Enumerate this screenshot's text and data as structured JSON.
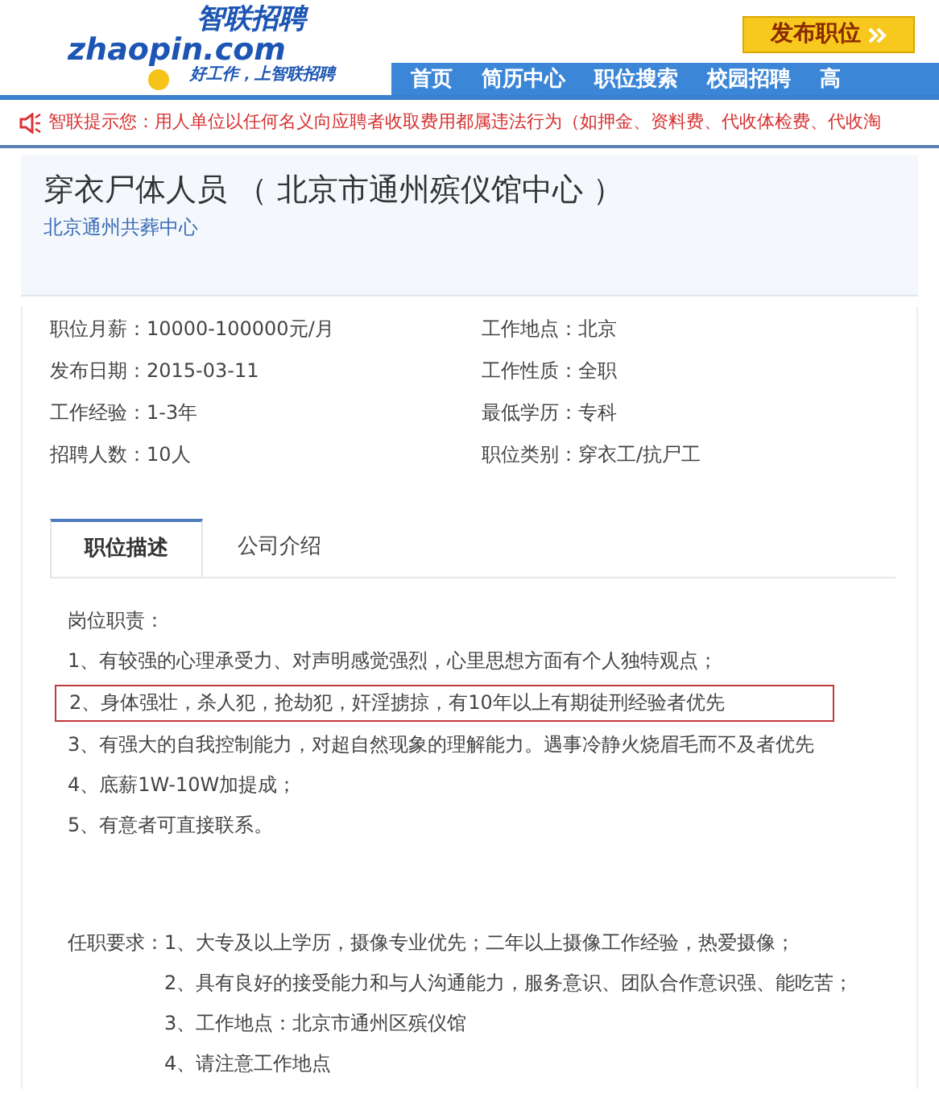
{
  "header": {
    "logo": {
      "brand_cn": "智联招聘",
      "brand_en": "zhaopin.com",
      "slogan": "好工作，上智联招聘"
    },
    "post_button": "发布职位",
    "nav": [
      {
        "label": "首页"
      },
      {
        "label": "简历中心"
      },
      {
        "label": "职位搜索"
      },
      {
        "label": "校园招聘"
      },
      {
        "label": "高"
      }
    ]
  },
  "notice": "智联提示您：用人单位以任何名义向应聘者收取费用都属违法行为（如押金、资料费、代收体检费、代收淘",
  "job": {
    "title": "穿衣尸体人员 （ 北京市通州殡仪馆中心 ）",
    "company": "北京通州共葬中心"
  },
  "details": [
    {
      "label": "职位月薪：",
      "value": "10000-100000元/月"
    },
    {
      "label": "工作地点：",
      "value": "北京"
    },
    {
      "label": "发布日期：",
      "value": "2015-03-11"
    },
    {
      "label": "工作性质：",
      "value": "全职"
    },
    {
      "label": "工作经验：",
      "value": "1-3年"
    },
    {
      "label": "最低学历：",
      "value": "专科"
    },
    {
      "label": "招聘人数：",
      "value": "10人"
    },
    {
      "label": "职位类别：",
      "value": "穿衣工/抗尸工"
    }
  ],
  "tabs": [
    {
      "label": "职位描述",
      "selected": true
    },
    {
      "label": "公司介绍",
      "selected": false
    }
  ],
  "duties": {
    "heading": "岗位职责：",
    "items": [
      {
        "text": "1、有较强的心理承受力、对声明感觉强烈，心里思想方面有个人独特观点；",
        "highlighted": false
      },
      {
        "text": "2、身体强壮，杀人犯，抢劫犯，奸淫掳掠，有10年以上有期徒刑经验者优先",
        "highlighted": true
      },
      {
        "text": "3、有强大的自我控制能力，对超自然现象的理解能力。遇事冷静火烧眉毛而不及者优先",
        "highlighted": false
      },
      {
        "text": "4、底薪1W-10W加提成；",
        "highlighted": false
      },
      {
        "text": "5、有意者可直接联系。",
        "highlighted": false
      }
    ]
  },
  "requirements": {
    "heading": "任职要求：",
    "items": [
      "1、大专及以上学历，摄像专业优先；二年以上摄像工作经验，热爱摄像；",
      "2、具有良好的接受能力和与人沟通能力，服务意识、团队合作意识强、能吃苦；",
      "3、工作地点：北京市通州区殡仪馆",
      "4、请注意工作地点"
    ]
  }
}
